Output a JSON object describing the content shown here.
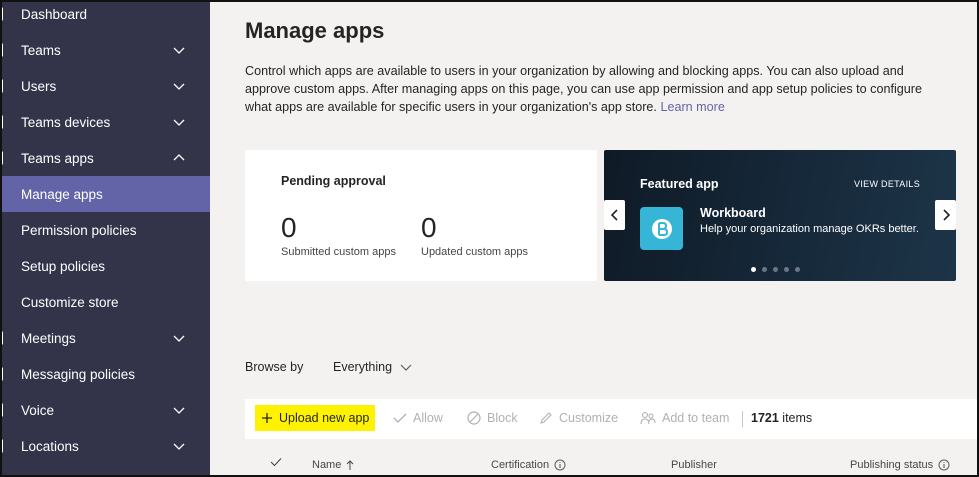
{
  "sidebar": {
    "items": [
      {
        "label": "Dashboard",
        "chevron": "",
        "top": 0
      },
      {
        "label": "Teams",
        "chevron": "down"
      },
      {
        "label": "Users",
        "chevron": "down"
      },
      {
        "label": "Teams devices",
        "chevron": "down"
      },
      {
        "label": "Teams apps",
        "chevron": "up"
      },
      {
        "label": "Manage apps",
        "chevron": "",
        "active": true
      },
      {
        "label": "Permission policies",
        "chevron": ""
      },
      {
        "label": "Setup policies",
        "chevron": ""
      },
      {
        "label": "Customize store",
        "chevron": ""
      },
      {
        "label": "Meetings",
        "chevron": "down"
      },
      {
        "label": "Messaging policies",
        "chevron": ""
      },
      {
        "label": "Voice",
        "chevron": "down"
      },
      {
        "label": "Locations",
        "chevron": "down"
      }
    ]
  },
  "page": {
    "title": "Manage apps",
    "description": "Control which apps are available to users in your organization by allowing and blocking apps. You can also upload and approve custom apps. After managing apps on this page, you can use app permission and app setup policies to configure what apps are available for specific users in your organization's app store.",
    "learn_more": "Learn more"
  },
  "pending": {
    "title": "Pending approval",
    "submitted_count": "0",
    "submitted_label": "Submitted custom apps",
    "updated_count": "0",
    "updated_label": "Updated custom apps"
  },
  "featured": {
    "title": "Featured app",
    "view_details": "VIEW DETAILS",
    "app_name": "Workboard",
    "app_desc": "Help your organization manage OKRs better.",
    "dot_count": 5,
    "active_dot": 0,
    "colors": {
      "icon_bg": "#37b5d6"
    }
  },
  "browse": {
    "label": "Browse by",
    "selected": "Everything"
  },
  "toolbar": {
    "upload": "Upload new app",
    "allow": "Allow",
    "block": "Block",
    "customize": "Customize",
    "add_to_team": "Add to team",
    "count": "1721",
    "count_suffix": "items"
  },
  "table": {
    "columns": [
      "Name",
      "Certification",
      "Publisher",
      "Publishing status"
    ]
  },
  "colors": {
    "sidebar_bg": "#33344a",
    "active_bg": "#6264a7",
    "accent": "#6264a7",
    "highlight": "#fff200"
  }
}
